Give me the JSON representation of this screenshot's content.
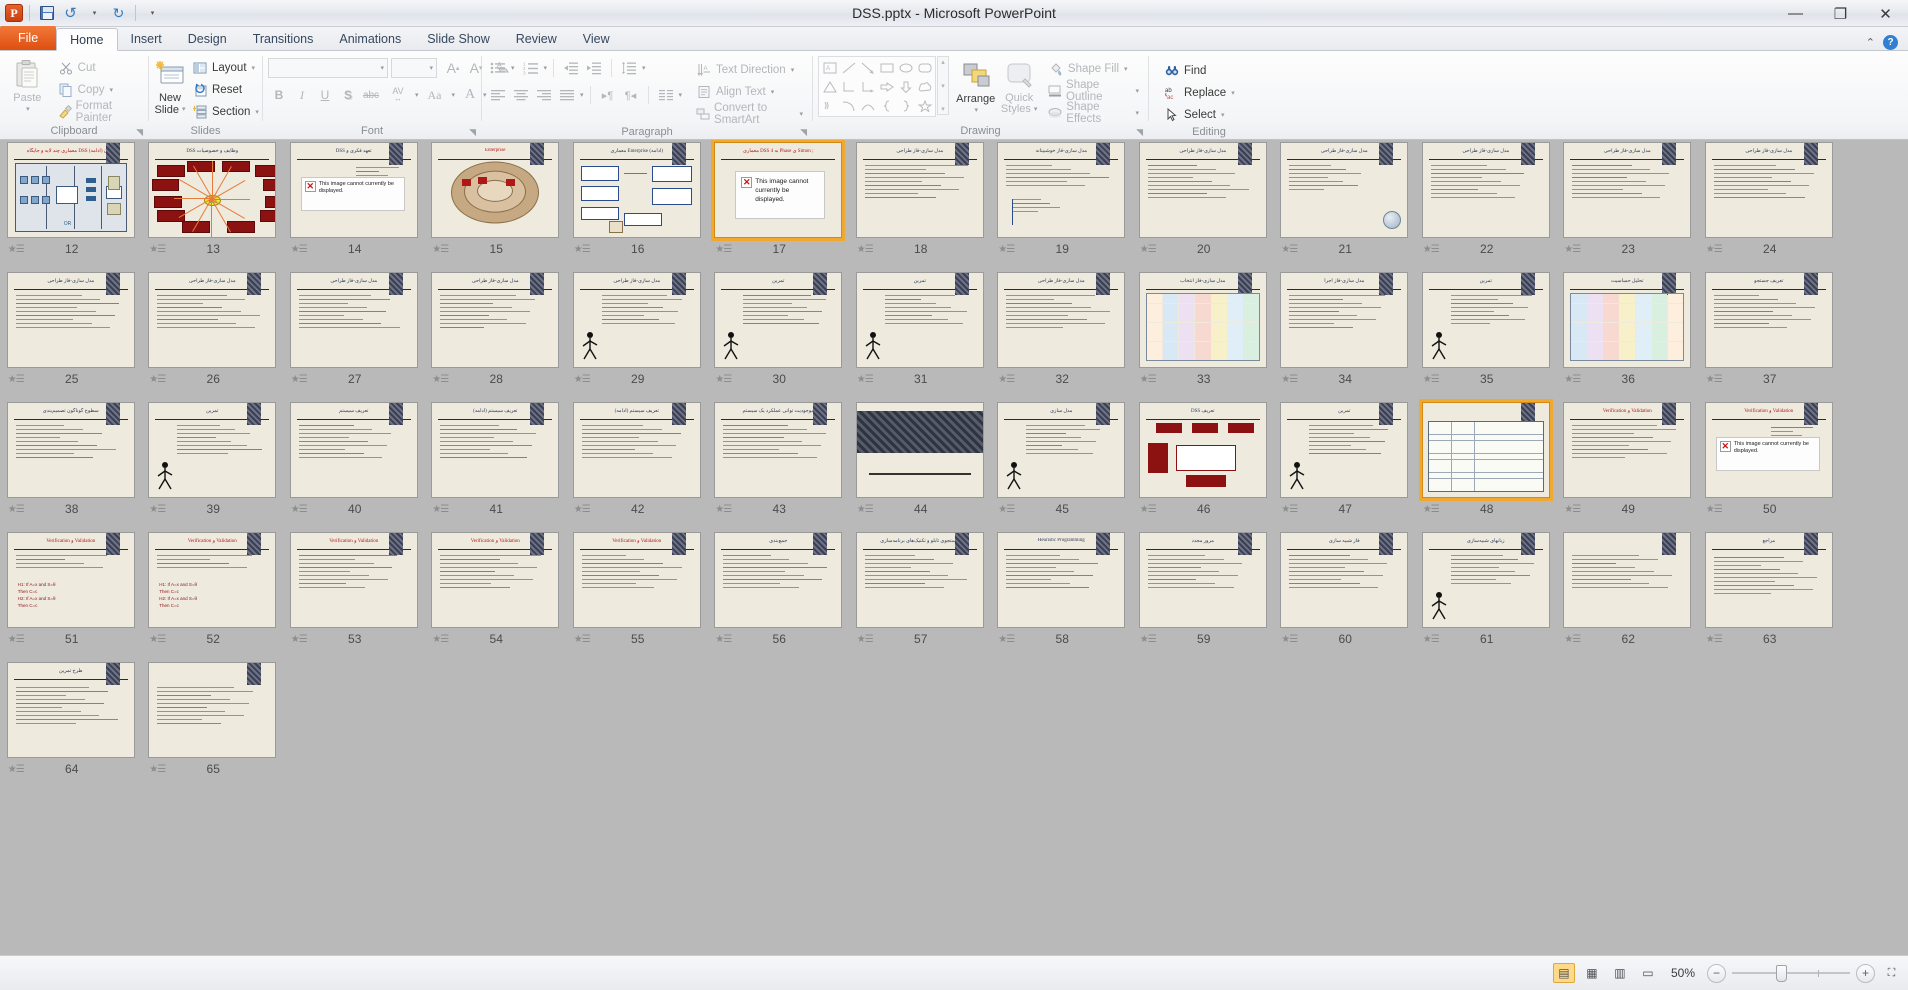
{
  "window": {
    "title": "DSS.pptx  -  Microsoft PowerPoint",
    "minimize": "—",
    "restore": "❐",
    "close": "✕"
  },
  "qat": {
    "app_logo": "P",
    "save": "save-icon",
    "undo": "↺",
    "undo_more": "▾",
    "redo": "↻",
    "customize": "▾"
  },
  "tabs": [
    {
      "label": "File",
      "kind": "file"
    },
    {
      "label": "Home",
      "kind": "active"
    },
    {
      "label": "Insert",
      "kind": "normal"
    },
    {
      "label": "Design",
      "kind": "normal"
    },
    {
      "label": "Transitions",
      "kind": "normal"
    },
    {
      "label": "Animations",
      "kind": "normal"
    },
    {
      "label": "Slide Show",
      "kind": "normal"
    },
    {
      "label": "Review",
      "kind": "normal"
    },
    {
      "label": "View",
      "kind": "normal"
    }
  ],
  "tab_right": {
    "minimize_ribbon": "⌃",
    "help": "?"
  },
  "ribbon": {
    "groups": [
      {
        "name": "Clipboard",
        "label": "Clipboard",
        "paste": "Paste",
        "paste_caret": "▾",
        "items": [
          {
            "label": "Cut",
            "icon": "scissors-icon"
          },
          {
            "label": "Copy",
            "icon": "copy-icon",
            "caret": "▾"
          },
          {
            "label": "Format Painter",
            "icon": "paintbrush-icon"
          }
        ],
        "dialog_launcher": "◥"
      },
      {
        "name": "Slides",
        "label": "Slides",
        "new_slide_line1": "New",
        "new_slide_line2": "Slide",
        "new_slide_caret": "▾",
        "items": [
          {
            "label": "Layout",
            "icon": "layout-icon",
            "caret": "▾"
          },
          {
            "label": "Reset",
            "icon": "reset-icon"
          },
          {
            "label": "Section",
            "icon": "section-icon",
            "caret": "▾"
          }
        ]
      },
      {
        "name": "Font",
        "label": "Font",
        "font_name_value": "",
        "font_size_value": "",
        "dialog_launcher": "◥",
        "buttons_row1": [
          "grow-font-icon",
          "shrink-font-icon",
          "clear-formatting-icon"
        ],
        "buttons_row2": [
          "bold-icon",
          "italic-icon",
          "underline-icon",
          "shadow-icon",
          "strikethrough-icon",
          "character-spacing-icon",
          "change-case-icon",
          "font-color-icon"
        ],
        "bold": "B",
        "italic": "I",
        "underline": "U",
        "shadow": "S",
        "strikethrough": "abc",
        "spacing": "AV",
        "case": "Aa",
        "color": "A",
        "grow": "A",
        "shrink": "A"
      },
      {
        "name": "Paragraph",
        "label": "Paragraph",
        "dialog_launcher": "◥",
        "items": [
          {
            "label": "Text Direction",
            "icon": "text-direction-icon",
            "caret": "▾"
          },
          {
            "label": "Align Text",
            "icon": "align-text-icon",
            "caret": "▾"
          },
          {
            "label": "Convert to SmartArt",
            "icon": "smartart-icon",
            "caret": "▾"
          }
        ]
      },
      {
        "name": "Drawing",
        "label": "Drawing",
        "dialog_launcher": "◥",
        "arrange": "Arrange",
        "arrange_caret": "▾",
        "quick_styles_line1": "Quick",
        "quick_styles_line2": "Styles",
        "quick_styles_caret": "▾",
        "items": [
          {
            "label": "Shape Fill",
            "icon": "shape-fill-icon",
            "caret": "▾"
          },
          {
            "label": "Shape Outline",
            "icon": "shape-outline-icon",
            "caret": "▾"
          },
          {
            "label": "Shape Effects",
            "icon": "shape-effects-icon",
            "caret": "▾"
          }
        ],
        "shapes": [
          "textbox",
          "line",
          "arrow",
          "rectangle",
          "oval",
          "rounded-rectangle",
          "triangle",
          "elbow-connector",
          "elbow-arrow-connector",
          "right-arrow",
          "down-arrow",
          "cloud",
          "freeform",
          "curve-down",
          "arc",
          "left-brace",
          "right-brace",
          "star"
        ],
        "shape_scroll": [
          "▴",
          "▾",
          "▾"
        ]
      },
      {
        "name": "Editing",
        "label": "Editing",
        "items": [
          {
            "label": "Find",
            "icon": "find-icon"
          },
          {
            "label": "Replace",
            "icon": "replace-icon",
            "caret": "▾"
          },
          {
            "label": "Select",
            "icon": "select-icon",
            "caret": "▾"
          }
        ]
      }
    ]
  },
  "sorter": {
    "transition_icon": "transition-star-icon",
    "selected_slide": 17,
    "error_message": "This image cannot currently be displayed.",
    "slides": [
      {
        "n": 12,
        "title": "معماری چند لایه و جایگاه DSS در آن  (ادامه)",
        "title_color": "red",
        "kind": "diagram-network",
        "corner": true
      },
      {
        "n": 13,
        "title": "DSS  وظایف و خصوصیات",
        "kind": "diagram-radial",
        "corner": false
      },
      {
        "n": 14,
        "title": "DSS تعهد فکری و",
        "kind": "error-image",
        "corner": true
      },
      {
        "n": 15,
        "title": "Enterprise",
        "title_color": "red",
        "kind": "diagram-oval",
        "corner": true
      },
      {
        "n": 16,
        "title": "معماری Enterprise (ادامه)",
        "kind": "diagram-boxes",
        "corner": true
      },
      {
        "n": 17,
        "title": "معماری DSS به 4 Phase ی Simon ;",
        "title_color": "red",
        "kind": "error-big",
        "corner": false,
        "selected": true
      },
      {
        "n": 18,
        "title": "مدل سازی-فاز طراحی",
        "kind": "bullets",
        "corner": true
      },
      {
        "n": 19,
        "title": "مدل سازی-فاز خوشبینانه",
        "kind": "bullets-code",
        "corner": true
      },
      {
        "n": 20,
        "title": "مدل سازی-فاز طراحی",
        "kind": "bullets",
        "corner": true
      },
      {
        "n": 21,
        "title": "مدل سازی-فاز طراحی",
        "kind": "bullets-globe",
        "corner": true
      },
      {
        "n": 22,
        "title": "مدل سازی-فاز طراحی",
        "kind": "bullets",
        "corner": true
      },
      {
        "n": 23,
        "title": "مدل سازی-فاز طراحی",
        "kind": "bullets",
        "corner": true
      },
      {
        "n": 24,
        "title": "مدل سازی-فاز طراحی",
        "kind": "bullets",
        "corner": true
      },
      {
        "n": 25,
        "title": "مدل سازی-فاز طراحی",
        "kind": "bullets",
        "corner": true
      },
      {
        "n": 26,
        "title": "مدل سازی-فاز طراحی",
        "kind": "bullets",
        "corner": true
      },
      {
        "n": 27,
        "title": "مدل سازی-فاز طراحی",
        "kind": "bullets",
        "corner": true
      },
      {
        "n": 28,
        "title": "مدل سازی-فاز طراحی",
        "kind": "bullets",
        "corner": true
      },
      {
        "n": 29,
        "title": "مدل سازی-فاز طراحی",
        "kind": "bullets-figure",
        "corner": true
      },
      {
        "n": 30,
        "title": "تمرین",
        "kind": "bullets-figure",
        "corner": true
      },
      {
        "n": 31,
        "title": "تمرین",
        "kind": "bullets-figure",
        "corner": true
      },
      {
        "n": 32,
        "title": "مدل سازی-فاز طراحی",
        "kind": "bullets",
        "corner": true
      },
      {
        "n": 33,
        "title": "مدل سازی-فاز انتخاب",
        "kind": "table-color",
        "corner": true
      },
      {
        "n": 34,
        "title": "مدل سازی-فاز اجرا",
        "kind": "bullets",
        "corner": true
      },
      {
        "n": 35,
        "title": "تمرین",
        "kind": "bullets-figure",
        "corner": true
      },
      {
        "n": 36,
        "title": "تحلیل حساسیت",
        "kind": "table-color",
        "corner": true
      },
      {
        "n": 37,
        "title": "تعریف جستجو",
        "kind": "bullets",
        "corner": true
      },
      {
        "n": 38,
        "title": "سطوح گوناگون تصمیم‌بندی",
        "kind": "bullets",
        "corner": true
      },
      {
        "n": 39,
        "title": "تمرین",
        "kind": "bullets-figure",
        "corner": true
      },
      {
        "n": 40,
        "title": "تعریف سیستم",
        "kind": "bullets",
        "corner": true
      },
      {
        "n": 41,
        "title": "تعریف سیستم (ادامه)",
        "kind": "bullets",
        "corner": true
      },
      {
        "n": 42,
        "title": "تعریف سیستم (ادامه)",
        "kind": "bullets",
        "corner": true
      },
      {
        "n": 43,
        "title": "موجودیت توانی عملکرد یک سیستم",
        "kind": "bullets",
        "corner": true
      },
      {
        "n": 44,
        "title": "",
        "kind": "dark-band",
        "corner": false
      },
      {
        "n": 45,
        "title": "مدل سازی",
        "kind": "bullets-figure",
        "corner": true
      },
      {
        "n": 46,
        "title": "DSS تعریف",
        "kind": "diagram-red",
        "corner": false
      },
      {
        "n": 47,
        "title": "تمرین",
        "kind": "bullets-figure",
        "corner": true
      },
      {
        "n": 48,
        "title": "",
        "kind": "table-grid",
        "corner": true,
        "selected_border": true
      },
      {
        "n": 49,
        "title": "Verification و Validation",
        "title_color": "red",
        "kind": "bullets",
        "corner": true
      },
      {
        "n": 50,
        "title": "Verification و Validation",
        "title_color": "red",
        "kind": "error-image",
        "corner": true
      },
      {
        "n": 51,
        "title": "Verification و Validation",
        "title_color": "red",
        "kind": "bullets-formula",
        "corner": true
      },
      {
        "n": 52,
        "title": "Verification و Validation",
        "title_color": "red",
        "kind": "bullets-formula",
        "corner": true
      },
      {
        "n": 53,
        "title": "Verification و Validation",
        "title_color": "red",
        "kind": "bullets",
        "corner": true
      },
      {
        "n": 54,
        "title": "Verification و Validation",
        "title_color": "red",
        "kind": "bullets",
        "corner": true
      },
      {
        "n": 55,
        "title": "Verification و Validation",
        "title_color": "red",
        "kind": "bullets",
        "corner": true
      },
      {
        "n": 56,
        "title": "جمع‌بندی",
        "kind": "bullets",
        "corner": true
      },
      {
        "n": 57,
        "title": "جستجوی تابلو و تکنیک‌های برنامه‌سازی",
        "kind": "bullets",
        "corner": true
      },
      {
        "n": 58,
        "title": "Heuristic Programming",
        "kind": "bullets",
        "corner": true
      },
      {
        "n": 59,
        "title": "مرور مجدد",
        "kind": "bullets",
        "corner": true
      },
      {
        "n": 60,
        "title": "فاز شبیه سازی",
        "kind": "bullets",
        "corner": true
      },
      {
        "n": 61,
        "title": "زبانهای شبیه‌سازی",
        "kind": "bullets-figure",
        "corner": true
      },
      {
        "n": 62,
        "title": "",
        "kind": "bullets",
        "corner": true
      },
      {
        "n": 63,
        "title": "مراجع",
        "kind": "refs",
        "corner": true
      },
      {
        "n": 64,
        "title": "طرح تمرین",
        "kind": "refs",
        "corner": true
      },
      {
        "n": 65,
        "title": "",
        "kind": "refs",
        "corner": true
      }
    ]
  },
  "statusbar": {
    "views": [
      {
        "name": "normal-view",
        "glyph": "▤",
        "active": true
      },
      {
        "name": "slide-sorter-view",
        "glyph": "▦",
        "active": false
      },
      {
        "name": "reading-view",
        "glyph": "▥",
        "active": false
      },
      {
        "name": "slide-show-view",
        "glyph": "▭",
        "active": false
      }
    ],
    "zoom_percent": "50%",
    "zoom_out": "−",
    "zoom_in": "+",
    "fit_to_window": "⛶"
  }
}
